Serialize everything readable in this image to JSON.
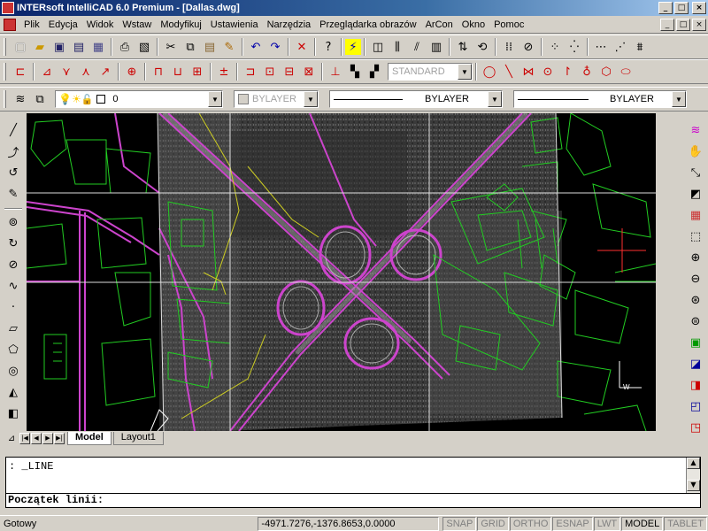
{
  "window": {
    "title": "INTERsoft IntelliCAD 6.0 Premium - [Dallas.dwg]",
    "min": "_",
    "max": "□",
    "close": "×"
  },
  "menu": [
    "Plik",
    "Edycja",
    "Widok",
    "Wstaw",
    "Modyfikuj",
    "Ustawienia",
    "Narzędzia",
    "Przeglądarka obrazów",
    "ArCon",
    "Okno",
    "Pomoc"
  ],
  "properties": {
    "layer": "0",
    "color": "BYLAYER",
    "linetype": "BYLAYER",
    "lineweight": "BYLAYER",
    "textstyle": "STANDARD"
  },
  "tabs": [
    "Model",
    "Layout1"
  ],
  "command": {
    "history": ": _LINE",
    "prompt": "Początek linii:"
  },
  "status": {
    "ready": "Gotowy",
    "coords": "-4971.7276,-1376.8653,0.0000",
    "toggles": [
      {
        "label": "SNAP",
        "on": false
      },
      {
        "label": "GRID",
        "on": false
      },
      {
        "label": "ORTHO",
        "on": false
      },
      {
        "label": "ESNAP",
        "on": false
      },
      {
        "label": "LWT",
        "on": false
      },
      {
        "label": "MODEL",
        "on": true
      },
      {
        "label": "TABLET",
        "on": false
      }
    ]
  },
  "colors": {
    "titlebar": "#0a246a",
    "canvas": "#000000",
    "parcels": "#22cc22",
    "roads": "#cc44cc",
    "grid": "#ffffff"
  }
}
